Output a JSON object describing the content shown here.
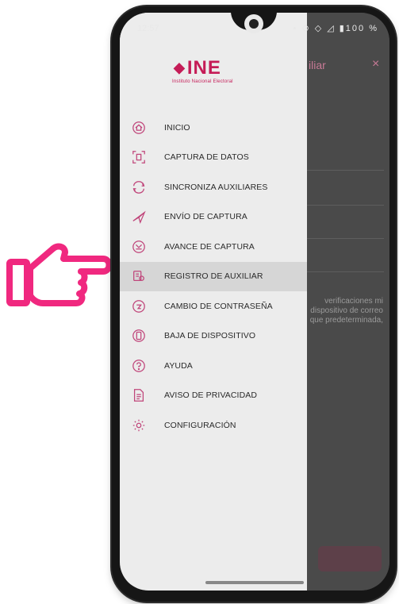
{
  "statusbar": {
    "time": "12:57",
    "icons_text": "• ⊙ ◇ ◿ ▮100 %"
  },
  "app": {
    "logo": "INE",
    "logo_subtitle": "Instituto Nacional Electoral",
    "background_title": "iliar",
    "background_close": "×",
    "background_paragraph": "verificaciones mi dispositivo de correo que predeterminada,"
  },
  "menu": {
    "items": [
      {
        "label": "INICIO",
        "icon": "home-icon"
      },
      {
        "label": "CAPTURA DE DATOS",
        "icon": "scan-icon"
      },
      {
        "label": "SINCRONIZA AUXILIARES",
        "icon": "sync-icon"
      },
      {
        "label": "ENVÍO DE CAPTURA",
        "icon": "send-icon"
      },
      {
        "label": "AVANCE DE CAPTURA",
        "icon": "progress-icon"
      },
      {
        "label": "REGISTRO DE AUXILIAR",
        "icon": "register-icon"
      },
      {
        "label": "CAMBIO DE CONTRASEÑA",
        "icon": "password-icon"
      },
      {
        "label": "BAJA DE DISPOSITIVO",
        "icon": "device-icon"
      },
      {
        "label": "AYUDA",
        "icon": "help-icon"
      },
      {
        "label": "AVISO DE PRIVACIDAD",
        "icon": "privacy-icon"
      },
      {
        "label": "CONFIGURACIÓN",
        "icon": "settings-icon"
      }
    ],
    "selected_index": 5
  },
  "colors": {
    "brand": "#c51c57",
    "icon": "#c0457a",
    "pointer": "#f0287f"
  }
}
